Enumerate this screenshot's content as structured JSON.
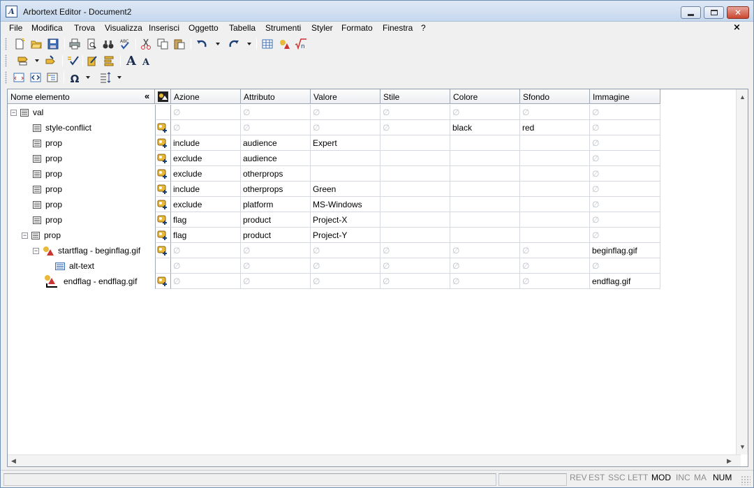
{
  "window": {
    "title": "Arbortext Editor - Document2",
    "app_icon_glyph": "A"
  },
  "menu": {
    "items": [
      "File",
      "Modifica",
      "Trova",
      "Visualizza",
      "Inserisci",
      "Oggetto",
      "Tabella",
      "Strumenti",
      "Styler",
      "Formato",
      "Finestra",
      "?"
    ],
    "close_glyph": "×"
  },
  "toolbar": {
    "font_large_glyph": "A",
    "font_small_glyph": "A",
    "omega_glyph": "Ω"
  },
  "table": {
    "tree_header": "Nome elemento",
    "collapse_glyph": "«",
    "columns": [
      "Azione",
      "Attributo",
      "Valore",
      "Stile",
      "Colore",
      "Sfondo",
      "Immagine"
    ],
    "empty_glyph": "∅",
    "rows": [
      {
        "label": "val",
        "cells": [
          "∅",
          "∅",
          "∅",
          "∅",
          "∅",
          "∅",
          "∅"
        ]
      },
      {
        "label": "style-conflict",
        "cells": [
          "∅",
          "∅",
          "∅",
          "∅",
          "black",
          "red",
          "∅"
        ]
      },
      {
        "label": "prop",
        "cells": [
          "include",
          "audience",
          "Expert",
          "",
          "",
          "",
          "∅"
        ]
      },
      {
        "label": "prop",
        "cells": [
          "exclude",
          "audience",
          "",
          "",
          "",
          "",
          "∅"
        ]
      },
      {
        "label": "prop",
        "cells": [
          "exclude",
          "otherprops",
          "",
          "",
          "",
          "",
          "∅"
        ]
      },
      {
        "label": "prop",
        "cells": [
          "include",
          "otherprops",
          "Green",
          "",
          "",
          "",
          "∅"
        ]
      },
      {
        "label": "prop",
        "cells": [
          "exclude",
          "platform",
          "MS-Windows",
          "",
          "",
          "",
          "∅"
        ]
      },
      {
        "label": "prop",
        "cells": [
          "flag",
          "product",
          "Project-X",
          "",
          "",
          "",
          "∅"
        ]
      },
      {
        "label": "prop",
        "cells": [
          "flag",
          "product",
          "Project-Y",
          "",
          "",
          "",
          "∅"
        ]
      },
      {
        "label": "startflag - beginflag.gif",
        "cells": [
          "∅",
          "∅",
          "∅",
          "∅",
          "∅",
          "∅",
          "beginflag.gif"
        ]
      },
      {
        "label": "alt-text",
        "cells": [
          "∅",
          "∅",
          "∅",
          "∅",
          "∅",
          "∅",
          "∅"
        ]
      },
      {
        "label": "endflag - endflag.gif",
        "cells": [
          "∅",
          "∅",
          "∅",
          "∅",
          "∅",
          "∅",
          "endflag.gif"
        ]
      }
    ]
  },
  "statusbar": {
    "indicators": [
      "REV",
      "EST",
      "SSC",
      "LETT",
      "MOD",
      "INC",
      "MA",
      "NUM"
    ],
    "active": [
      "MOD",
      "NUM"
    ]
  },
  "colors": {
    "titlebar_top": "#dfe9f5",
    "empty_symbol": "#b8bfc8",
    "grid_line": "#d4d9e0"
  }
}
